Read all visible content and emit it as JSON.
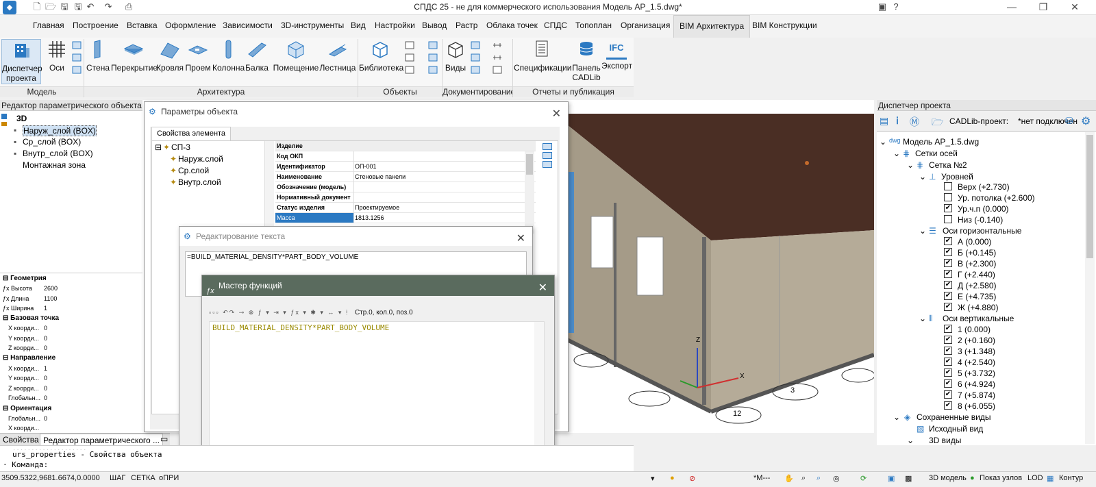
{
  "window": {
    "title": "СПДС 25 - не для коммерческого использования Модель АР_1.5.dwg*",
    "help": "?",
    "minimize": "—",
    "restore": "❐",
    "close": "✕"
  },
  "menu": {
    "tabs": [
      "Главная",
      "Построение",
      "Вставка",
      "Оформление",
      "Зависимости",
      "3D-инструменты",
      "Вид",
      "Настройки",
      "Вывод",
      "Растр",
      "Облака точек",
      "СПДС",
      "Топоплан",
      "Организация",
      "BIM Архитектура",
      "BIM Конструкции"
    ],
    "active": "BIM Архитектура"
  },
  "ribbon": {
    "groups": {
      "model": "Модель",
      "architecture": "Архитектура",
      "objects": "Объекты",
      "documentation": "Документирование",
      "reports": "Отчеты и публикация"
    },
    "buttons": {
      "dispatcher_line1": "Диспетчер",
      "dispatcher_line2": "проекта",
      "axes": "Оси",
      "wall": "Стена",
      "slab": "Перекрытие",
      "roof": "Кровля",
      "opening": "Проем",
      "column": "Колонна",
      "beam": "Балка",
      "room": "Помещение",
      "stair": "Лестница",
      "library": "Библиотека",
      "views": "Виды",
      "specs": "Спецификации",
      "panel_line1": "Панель",
      "panel_line2": "CADLib",
      "export": "Экспорт",
      "ifc": "IFC"
    }
  },
  "param_editor": {
    "title": "Редактор параметрического объекта",
    "tree": [
      "3D",
      "Наруж_слой (BOX)",
      "Ср_слой (BOX)",
      "Внутр_слой (BOX)",
      "Монтажная зона"
    ],
    "selected": "Наруж_слой (BOX)"
  },
  "properties_panel": {
    "sections": {
      "geometry": "Геометрия",
      "base_point": "Базовая точка",
      "direction": "Направление",
      "orientation": "Ориентация"
    },
    "rows": {
      "height_k": "Высота",
      "height_v": "2600",
      "length_k": "Длина",
      "length_v": "1100",
      "width_k": "Ширина",
      "width_v": "1",
      "bx_k": "X коорди...",
      "bx_v": "0",
      "by_k": "Y коорди...",
      "by_v": "0",
      "bz_k": "Z коорди...",
      "bz_v": "0",
      "dx_k": "X коорди...",
      "dx_v": "1",
      "dy_k": "Y коорди...",
      "dy_v": "0",
      "dz_k": "Z коорди...",
      "dz_v": "0",
      "dg_k": "Глобальн...",
      "dg_v": "0",
      "og_k": "Глобальн...",
      "og_v": "0",
      "ox_k": "X коорди...",
      "ox_v": ""
    },
    "bottom_tabs": [
      "Свойства",
      "Редактор параметрического ..."
    ]
  },
  "object_params": {
    "title": "Параметры объекта",
    "tab": "Свойства элемента",
    "tree": [
      "СП-3",
      "Наруж.слой",
      "Ср.слой",
      "Внутр.слой"
    ],
    "section": "Изделие",
    "rows": [
      {
        "k": "Код ОКП",
        "v": ""
      },
      {
        "k": "Идентификатор",
        "v": "ОП-001"
      },
      {
        "k": "Наименование",
        "v": "Стеновые панели"
      },
      {
        "k": "Обозначение (модель)",
        "v": ""
      },
      {
        "k": "Нормативный документ",
        "v": ""
      },
      {
        "k": "Статус изделия",
        "v": "Проектируемое"
      },
      {
        "k": "Масса",
        "v": "1813.1256"
      }
    ]
  },
  "text_edit": {
    "title": "Редактирование текста",
    "value": "=BUILD_MATERIAL_DENSITY*PART_BODY_VOLUME"
  },
  "func_master": {
    "title": "Мастер функций",
    "position": "Стр.0, кол.0, поз.0",
    "code": "BUILD_MATERIAL_DENSITY*PART_BODY_VOLUME"
  },
  "command_line": {
    "line1": "urs_properties - Свойства объекта",
    "prompt": "Команда:",
    "partial": "...................."
  },
  "project_manager": {
    "title": "Диспетчер проекта",
    "cadlib_label": "CADLib-проект:",
    "cadlib_value": "*нет подключен",
    "tree": {
      "model": "Модель АР_1.5.dwg",
      "axes_grids": "Сетки осей",
      "grid2": "Сетка №2",
      "levels": "Уровней",
      "level_items": [
        {
          "label": "Верх (+2.730)",
          "checked": false
        },
        {
          "label": "Ур. потолка (+2.600)",
          "checked": false
        },
        {
          "label": "Ур.ч.п (0.000)",
          "checked": true
        },
        {
          "label": "Низ (-0.140)",
          "checked": false
        }
      ],
      "horiz": "Оси горизонтальные",
      "horiz_items": [
        "А (0.000)",
        "Б (+0.145)",
        "В (+2.300)",
        "Г (+2.440)",
        "Д (+2.580)",
        "Е (+4.735)",
        "Ж (+4.880)"
      ],
      "vert": "Оси вертикальные",
      "vert_items": [
        "1 (0.000)",
        "2 (+0.160)",
        "3 (+1.348)",
        "4 (+2.540)",
        "5 (+3.732)",
        "6 (+4.924)",
        "7 (+5.874)",
        "8 (+6.055)"
      ],
      "saved_views": "Сохраненные виды",
      "initial_view": "Исходный вид",
      "views3d": "3D виды"
    }
  },
  "status": {
    "coords": "3509.5322,9681.6674,0.0000",
    "step": "ШАГ",
    "grid": "СЕТКА",
    "snap": "оПРИ",
    "model3d": "3D модель",
    "nodes": "Показ узлов",
    "lod": "LOD",
    "outline": "Контур",
    "mtag": "*М---"
  },
  "viewport": {
    "axis_z": "Z",
    "axis_x": "X",
    "bubbles": [
      "3",
      "12"
    ]
  },
  "colors": {
    "accent": "#2b79c2",
    "func_title_bg": "#5a6b5e",
    "roof": "#4a2e24",
    "wall": "#b5ab98"
  }
}
